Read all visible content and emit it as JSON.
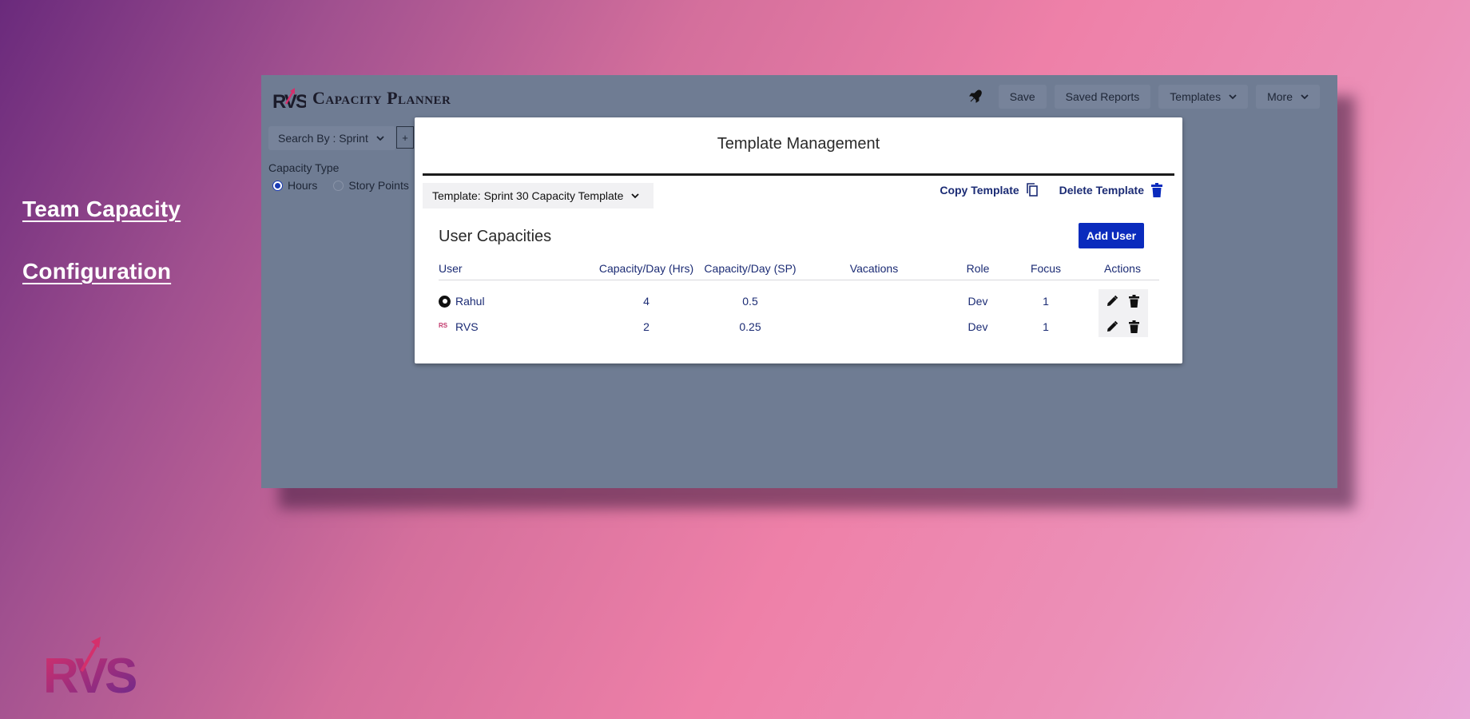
{
  "side": {
    "link1": "Team Capacity",
    "link2": "Configuration"
  },
  "app": {
    "title": "Capacity Planner",
    "logo_text": "RVS",
    "toolbar": {
      "save": "Save",
      "saved_reports": "Saved Reports",
      "templates": "Templates",
      "more": "More"
    },
    "search_by": "Search By : Sprint",
    "plus": "+",
    "capacity_type_label": "Capacity Type",
    "capacity_options": [
      {
        "label": "Hours",
        "selected": true
      },
      {
        "label": "Story Points",
        "selected": false
      }
    ]
  },
  "modal": {
    "title": "Template Management",
    "template_select": "Template: Sprint 30 Capacity Template",
    "copy_template": "Copy Template",
    "delete_template": "Delete Template",
    "section_title": "User Capacities",
    "add_user": "Add User",
    "columns": [
      "User",
      "Capacity/Day (Hrs)",
      "Capacity/Day (SP)",
      "Vacations",
      "Role",
      "Focus",
      "Actions"
    ],
    "rows": [
      {
        "user": "Rahul",
        "hrs": "4",
        "sp": "0.5",
        "vacations": "",
        "role": "Dev",
        "focus": "1"
      },
      {
        "user": "RVS",
        "hrs": "2",
        "sp": "0.25",
        "vacations": "",
        "role": "Dev",
        "focus": "1"
      }
    ]
  },
  "colors": {
    "accent_blue": "#0a2bbd",
    "link_navy": "#1b2b74",
    "app_bg": "#6f7c93",
    "brand_pink": "#d4306c",
    "brand_purple": "#6a2a8c"
  },
  "icons": [
    "rocket-icon",
    "chevron-down-icon",
    "copy-icon",
    "trash-icon",
    "pencil-icon"
  ]
}
